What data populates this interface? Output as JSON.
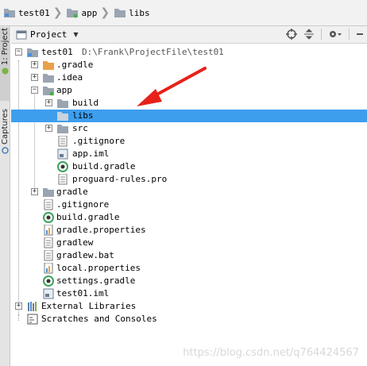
{
  "breadcrumb": [
    "test01",
    "app",
    "libs"
  ],
  "side_tabs": {
    "project": "1: Project",
    "captures": "Captures"
  },
  "panel": {
    "title": "Project"
  },
  "tree": {
    "root_name": "test01",
    "root_path": "D:\\Frank\\ProjectFile\\test01",
    "items": [
      ".gradle",
      ".idea",
      "app",
      "build",
      "libs",
      "src",
      ".gitignore",
      "app.iml",
      "build.gradle",
      "proguard-rules.pro",
      "gradle",
      ".gitignore",
      "build.gradle",
      "gradle.properties",
      "gradlew",
      "gradlew.bat",
      "local.properties",
      "settings.gradle",
      "test01.iml",
      "External Libraries",
      "Scratches and Consoles"
    ]
  },
  "watermark": "https://blog.csdn.net/q764424567",
  "colors": {
    "selection": "#3d9eee",
    "folder": "#9aa5b1",
    "gradle_folder": "#e8a14a",
    "arrow": "#e8201a",
    "module_dot": "#4caf50"
  }
}
